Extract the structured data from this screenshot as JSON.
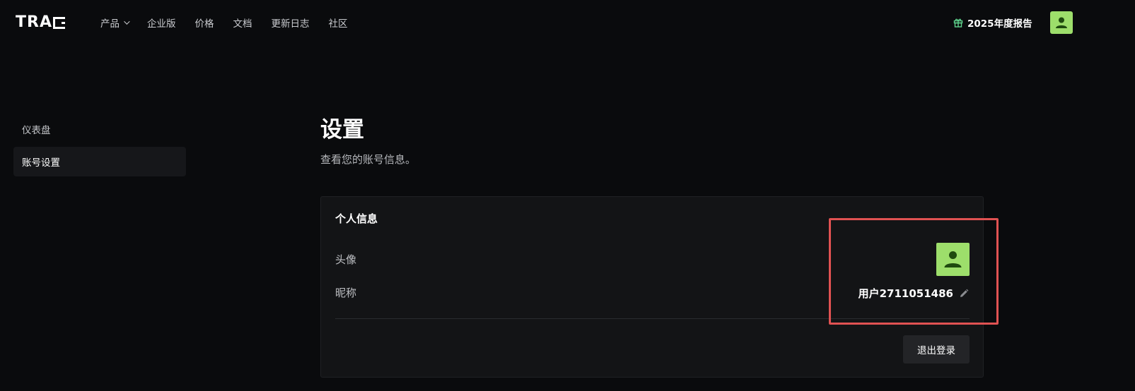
{
  "brand": {
    "logo_text": "TRA"
  },
  "nav": {
    "items": [
      {
        "label": "产品",
        "has_dropdown": true
      },
      {
        "label": "企业版"
      },
      {
        "label": "价格"
      },
      {
        "label": "文档"
      },
      {
        "label": "更新日志"
      },
      {
        "label": "社区"
      }
    ],
    "report_label": "2025年度报告"
  },
  "sidebar": {
    "items": [
      {
        "label": "仪表盘",
        "active": false
      },
      {
        "label": "账号设置",
        "active": true
      }
    ]
  },
  "main": {
    "title": "设置",
    "subtitle": "查看您的账号信息。",
    "card": {
      "title": "个人信息",
      "avatar_label": "头像",
      "nickname_label": "昵称",
      "nickname": "用户2711051486",
      "logout_label": "退出登录"
    }
  },
  "colors": {
    "background": "#0a0b0d",
    "card": "#131416",
    "avatar_bg": "#9dde6b",
    "avatar_figure": "#1f4a0f",
    "gift_icon": "#5fd38d",
    "highlight": "#e05252"
  },
  "icons": {
    "gift": "gift-icon",
    "chevron": "chevron-down-icon",
    "avatar": "user-avatar-icon",
    "edit": "pencil-icon"
  }
}
